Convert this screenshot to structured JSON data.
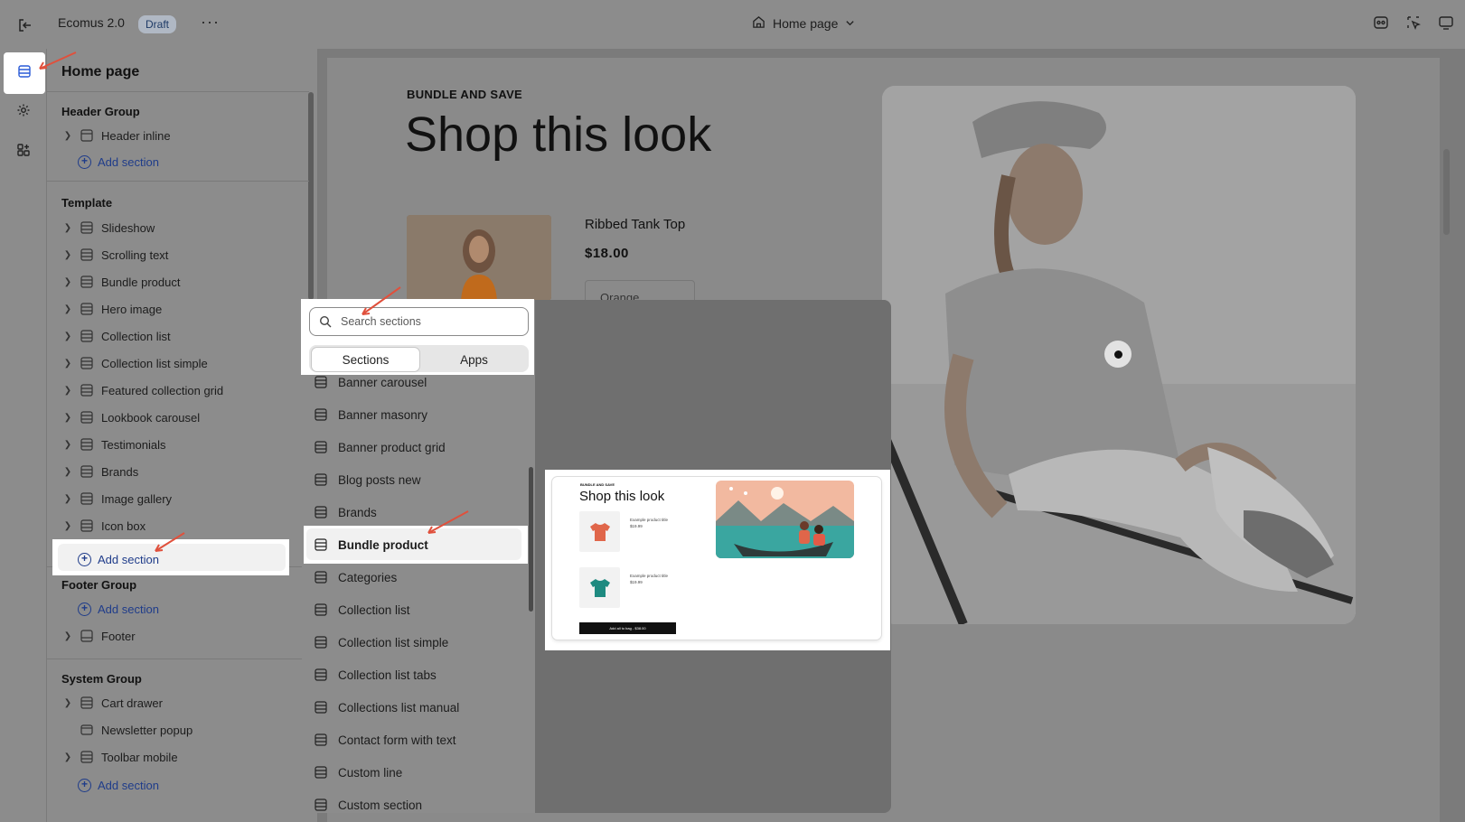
{
  "topbar": {
    "title": "Ecomus 2.0",
    "badge": "Draft",
    "more": "···",
    "page_selector": "Home page"
  },
  "sidebar": {
    "title": "Home page",
    "header_group": {
      "title": "Header Group",
      "items": [
        {
          "label": "Header inline"
        }
      ],
      "add_label": "Add section"
    },
    "template": {
      "title": "Template",
      "items": [
        {
          "label": "Slideshow"
        },
        {
          "label": "Scrolling text"
        },
        {
          "label": "Bundle product"
        },
        {
          "label": "Hero image"
        },
        {
          "label": "Collection list"
        },
        {
          "label": "Collection list simple"
        },
        {
          "label": "Featured collection grid"
        },
        {
          "label": "Lookbook carousel"
        },
        {
          "label": "Testimonials"
        },
        {
          "label": "Brands"
        },
        {
          "label": "Image gallery"
        },
        {
          "label": "Icon box"
        }
      ],
      "add_label": "Add section"
    },
    "footer_group": {
      "title": "Footer Group",
      "add_label": "Add section",
      "items": [
        {
          "label": "Footer"
        }
      ]
    },
    "system_group": {
      "title": "System Group",
      "items": [
        {
          "label": "Cart drawer"
        },
        {
          "label": "Newsletter popup"
        },
        {
          "label": "Toolbar mobile"
        }
      ],
      "add_label": "Add section"
    }
  },
  "preview": {
    "eyebrow": "BUNDLE AND SAVE",
    "heading": "Shop this look",
    "product_name": "Ribbed Tank Top",
    "product_price": "$18.00",
    "variant_select": "Orange"
  },
  "picker": {
    "search_placeholder": "Search sections",
    "tabs": [
      {
        "label": "Sections"
      },
      {
        "label": "Apps"
      }
    ],
    "active_tab": "Sections",
    "items": [
      {
        "label": "Banner carousel"
      },
      {
        "label": "Banner masonry"
      },
      {
        "label": "Banner product grid"
      },
      {
        "label": "Blog posts new"
      },
      {
        "label": "Brands"
      },
      {
        "label": "Bundle product"
      },
      {
        "label": "Categories"
      },
      {
        "label": "Collection list"
      },
      {
        "label": "Collection list simple"
      },
      {
        "label": "Collection list tabs"
      },
      {
        "label": "Collections list manual"
      },
      {
        "label": "Contact form with text"
      },
      {
        "label": "Custom line"
      },
      {
        "label": "Custom section"
      }
    ],
    "selected_item": "Bundle product",
    "preview_card": {
      "eyebrow": "BUNDLE AND SAVE",
      "title": "Shop this look",
      "product_title": "Example product title",
      "product_price": "$19.99",
      "button_label": "Add all to bag - $38.00"
    }
  },
  "colors": {
    "accent": "#1f3c8a",
    "highlight": "#ffffff",
    "annotation_arrow": "#e0503c",
    "overlay": "#7b7b7b"
  }
}
